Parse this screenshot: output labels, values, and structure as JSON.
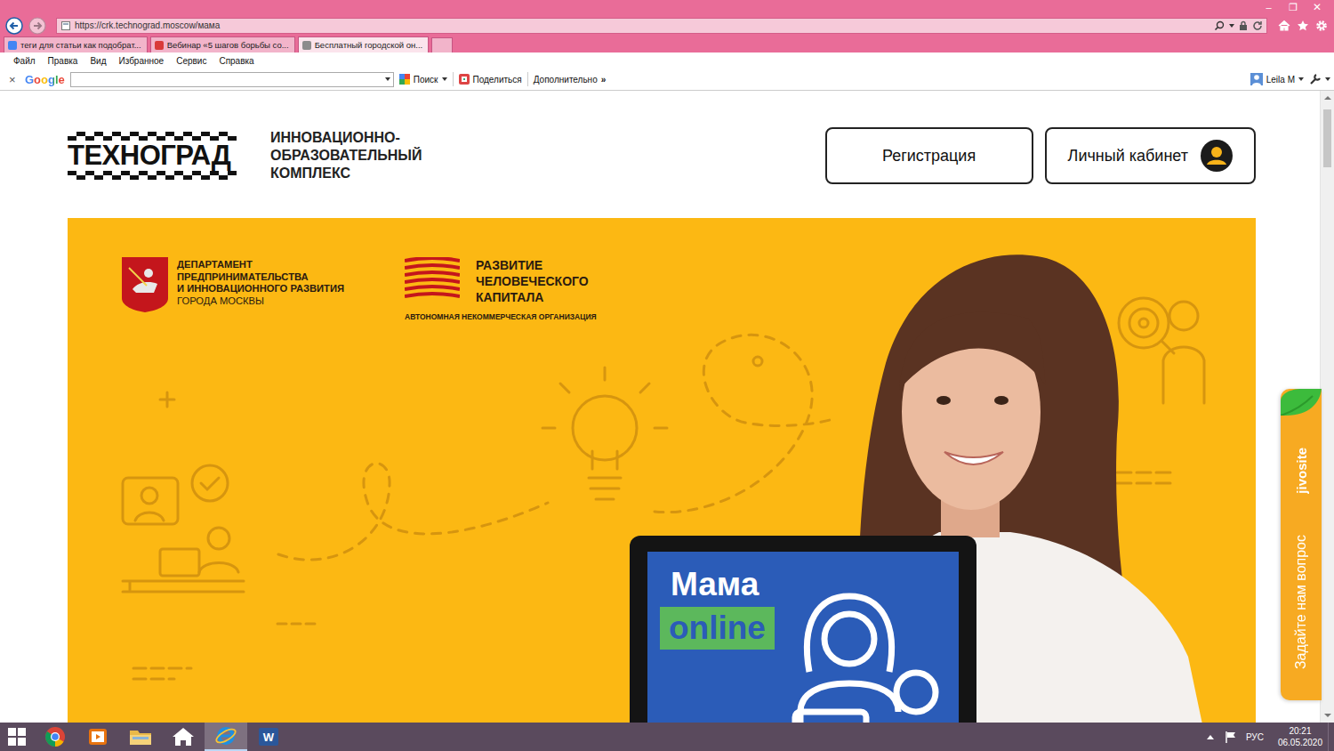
{
  "window": {
    "controls": [
      "–",
      "❐",
      "✕"
    ]
  },
  "address_bar": {
    "url": "https://crk.technograd.moscow/мама"
  },
  "tabs": [
    {
      "label": "теги для статьи как подобрат...",
      "selected": false,
      "color": "#4285f4"
    },
    {
      "label": "Вебинар «5 шагов борьбы со...",
      "selected": false,
      "color": "#d93a3a"
    },
    {
      "label": "Бесплатный городской он...",
      "selected": true,
      "color": "#8c8c8c"
    }
  ],
  "menu": [
    "Файл",
    "Правка",
    "Вид",
    "Избранное",
    "Сервис",
    "Справка"
  ],
  "toolbar": {
    "close": "×",
    "brand": "Google",
    "search_button": "Поиск",
    "share": "Поделиться",
    "more": "Дополнительно",
    "more_glyph": "»",
    "user": "Leila M"
  },
  "page": {
    "logo": "ТЕХНОГРАД",
    "tagline": [
      "ИННОВАЦИОННО-",
      "ОБРАЗОВАТЕЛЬНЫЙ",
      "КОМПЛЕКС"
    ],
    "buttons": [
      {
        "label": "Регистрация",
        "kind": "text"
      },
      {
        "label": "Личный кабинет",
        "kind": "avatar"
      }
    ]
  },
  "banner": {
    "partners": [
      {
        "kind": "emblem",
        "lines": [
          "ДЕПАРТАМЕНТ",
          "ПРЕДПРИНИМАТЕЛЬСТВА",
          "И ИННОВАЦИОННОГО РАЗВИТИЯ"
        ],
        "subtitle": "ГОРОДА МОСКВЫ"
      },
      {
        "kind": "stripes",
        "lines": [
          "РАЗВИТИЕ",
          "ЧЕЛОВЕЧЕСКОГО",
          "КАПИТАЛА"
        ],
        "subtitle": "АВТОНОМНАЯ НЕКОММЕРЧЕСКАЯ ОРГАНИЗАЦИЯ"
      }
    ],
    "screen_title": "Мама",
    "screen_badge": "online"
  },
  "chat_widget": {
    "brand": "jivosite",
    "label": "Задайте нам вопрос"
  },
  "taskbar": {
    "apps": [
      {
        "kind": "chrome",
        "selected": false
      },
      {
        "kind": "media",
        "selected": false
      },
      {
        "kind": "explorer",
        "selected": false
      },
      {
        "kind": "home",
        "selected": false
      },
      {
        "kind": "ie",
        "selected": true
      },
      {
        "kind": "word",
        "selected": false,
        "label": "W"
      }
    ],
    "lang": "РУС",
    "time": "20:21",
    "date": "06.05.2020"
  }
}
